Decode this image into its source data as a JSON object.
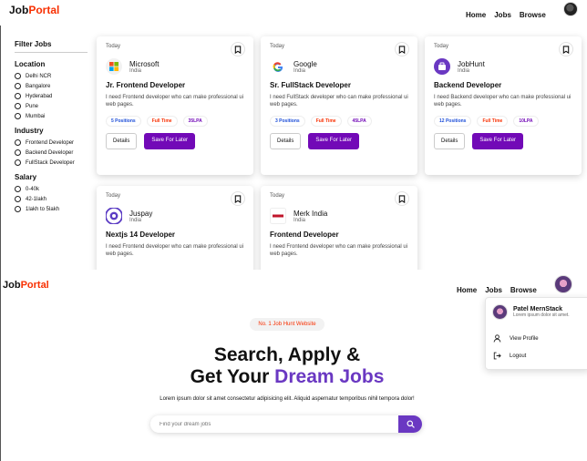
{
  "top": {
    "logo": {
      "prefix": "Job",
      "accent": "Portal"
    },
    "nav": [
      "Home",
      "Jobs",
      "Browse"
    ],
    "filter": {
      "title": "Filter Jobs",
      "sections": [
        {
          "title": "Location",
          "options": [
            "Delhi NCR",
            "Bangalore",
            "Hyderabad",
            "Pune",
            "Mumbai"
          ]
        },
        {
          "title": "Industry",
          "options": [
            "Frontend Developer",
            "Backend Developer",
            "FullStack Developer"
          ]
        },
        {
          "title": "Salary",
          "options": [
            "0-40k",
            "42-1lakh",
            "1lakh to 5lakh"
          ]
        }
      ]
    },
    "jobs": [
      {
        "posted": "Today",
        "company": "Microsoft",
        "location": "India",
        "title": "Jr. Frontend Developer",
        "description": "I need Frontend developer who can make professional ui web pages.",
        "positions": "5 Positions",
        "type": "Full Time",
        "salary": "35LPA",
        "details": "Details",
        "save": "Save For Later"
      },
      {
        "posted": "Today",
        "company": "Google",
        "location": "India",
        "title": "Sr. FullStack Developer",
        "description": "I need FullStack developer who can make professional ui web pages.",
        "positions": "3 Positions",
        "type": "Full Time",
        "salary": "45LPA",
        "details": "Details",
        "save": "Save For Later"
      },
      {
        "posted": "Today",
        "company": "JobHunt",
        "location": "India",
        "title": "Backend Developer",
        "description": "I need Backend developer who can make professional ui web pages.",
        "positions": "12 Positions",
        "type": "Full Time",
        "salary": "10LPA",
        "details": "Details",
        "save": "Save For Later"
      },
      {
        "posted": "Today",
        "company": "Juspay",
        "location": "India",
        "title": "Nextjs 14 Developer",
        "description": "I need Frontend developer who can make professional ui web pages."
      },
      {
        "posted": "Today",
        "company": "Merk India",
        "location": "India",
        "title": "Frontend Developer",
        "description": "I need Frontend developer who can make professional ui web pages."
      }
    ]
  },
  "bottom": {
    "logo": {
      "prefix": "Job",
      "accent": "Portal"
    },
    "nav": [
      "Home",
      "Jobs",
      "Browse"
    ],
    "badge": "No. 1 Job Hunt Website",
    "headline": {
      "line1": "Search, Apply &",
      "line2_prefix": "Get Your ",
      "line2_accent": "Dream Jobs"
    },
    "subtext": "Lorem ipsum dolor sit amet consectetur adipisicing elit. Aliquid aspernatur temporibus nihil tempora dolor!",
    "search": {
      "placeholder": "Find your dream jobs"
    },
    "profile": {
      "name": "Patel MernStack",
      "bio": "Lorem ipsum dolor sit amet.",
      "view_profile": "View Profile",
      "logout": "Logout"
    }
  },
  "colors": {
    "accent_red": "#F83002",
    "primary_purple": "#7209b7",
    "hero_purple": "#6A38C2"
  }
}
